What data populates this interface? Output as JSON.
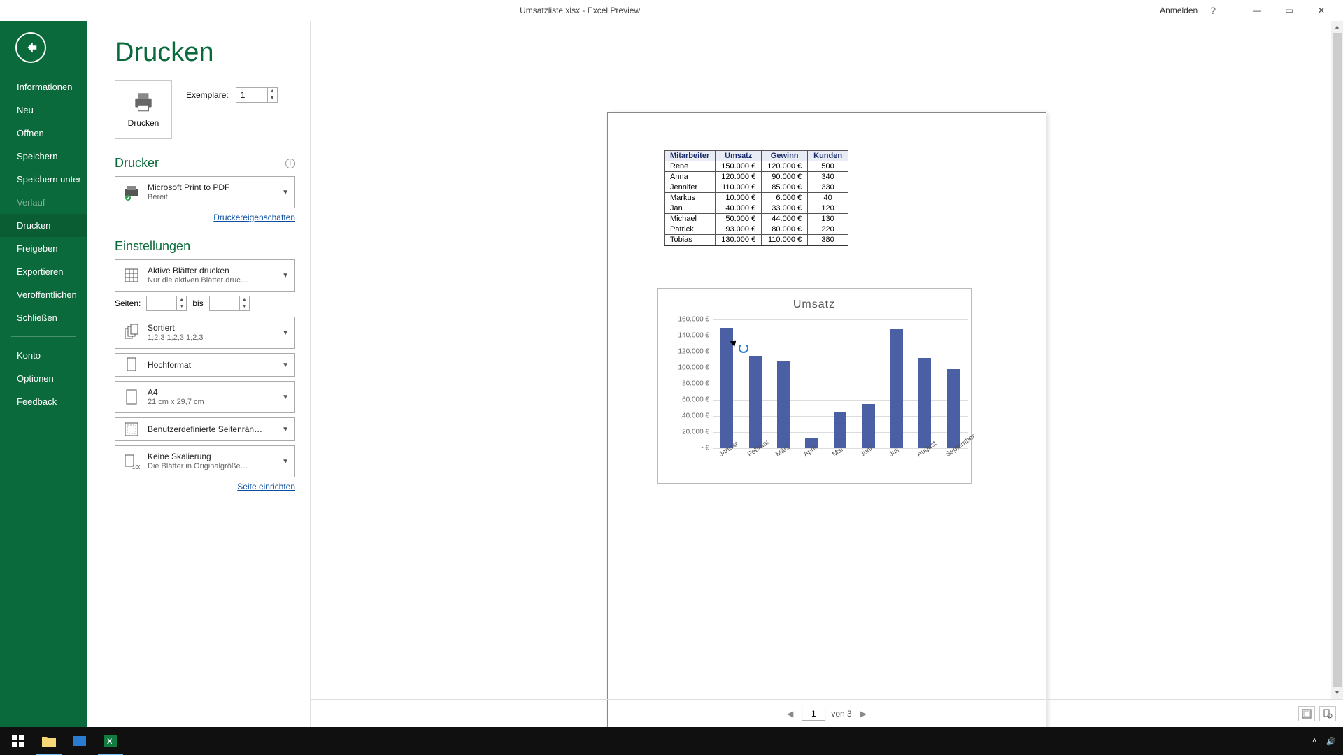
{
  "titlebar": {
    "title": "Umsatzliste.xlsx - Excel Preview",
    "signin": "Anmelden",
    "help": "?"
  },
  "sidebar": {
    "items": [
      {
        "label": "Informationen"
      },
      {
        "label": "Neu"
      },
      {
        "label": "Öffnen"
      },
      {
        "label": "Speichern"
      },
      {
        "label": "Speichern unter"
      },
      {
        "label": "Verlauf",
        "disabled": true
      },
      {
        "label": "Drucken",
        "active": true
      },
      {
        "label": "Freigeben"
      },
      {
        "label": "Exportieren"
      },
      {
        "label": "Veröffentlichen"
      },
      {
        "label": "Schließen"
      }
    ],
    "items2": [
      {
        "label": "Konto"
      },
      {
        "label": "Optionen"
      },
      {
        "label": "Feedback"
      }
    ]
  },
  "print": {
    "heading": "Drucken",
    "print_button": "Drucken",
    "copies_label": "Exemplare:",
    "copies_value": "1",
    "printer_section": "Drucker",
    "printer_name": "Microsoft Print to PDF",
    "printer_status": "Bereit",
    "printer_props": "Druckereigenschaften",
    "settings_section": "Einstellungen",
    "settings": {
      "sheets_main": "Aktive Blätter drucken",
      "sheets_sub": "Nur die aktiven Blätter druc…",
      "pages_label": "Seiten:",
      "pages_to": "bis",
      "collate_main": "Sortiert",
      "collate_sub": "1;2;3    1;2;3    1;2;3",
      "orientation": "Hochformat",
      "paper_main": "A4",
      "paper_sub": "21 cm x 29,7 cm",
      "margins": "Benutzerdefinierte Seitenrän…",
      "scaling_main": "Keine Skalierung",
      "scaling_sub": "Die Blätter in Originalgröße…",
      "page_setup": "Seite einrichten"
    }
  },
  "footer": {
    "page_value": "1",
    "of_text": "von 3"
  },
  "table": {
    "headers": [
      "Mitarbeiter",
      "Umsatz",
      "Gewinn",
      "Kunden"
    ],
    "rows": [
      [
        "Rene",
        "150.000 €",
        "120.000 €",
        "500"
      ],
      [
        "Anna",
        "120.000 €",
        "90.000 €",
        "340"
      ],
      [
        "Jennifer",
        "110.000 €",
        "85.000 €",
        "330"
      ],
      [
        "Markus",
        "10.000 €",
        "6.000 €",
        "40"
      ],
      [
        "Jan",
        "40.000 €",
        "33.000 €",
        "120"
      ],
      [
        "Michael",
        "50.000 €",
        "44.000 €",
        "130"
      ],
      [
        "Patrick",
        "93.000 €",
        "80.000 €",
        "220"
      ],
      [
        "Tobias",
        "130.000 €",
        "110.000 €",
        "380"
      ]
    ]
  },
  "chart_data": {
    "type": "bar",
    "title": "Umsatz",
    "categories": [
      "Januar",
      "Februar",
      "März",
      "April",
      "Mai",
      "Juni",
      "Juli",
      "August",
      "September"
    ],
    "values": [
      150000,
      115000,
      108000,
      12000,
      45000,
      55000,
      148000,
      112000,
      98000
    ],
    "ylabel": "",
    "xlabel": "",
    "ylim": [
      0,
      160000
    ],
    "yticks": [
      "160.000 €",
      "140.000 €",
      "120.000 €",
      "100.000 €",
      "80.000 €",
      "60.000 €",
      "40.000 €",
      "20.000 €",
      "-   €"
    ],
    "currency": "€"
  }
}
